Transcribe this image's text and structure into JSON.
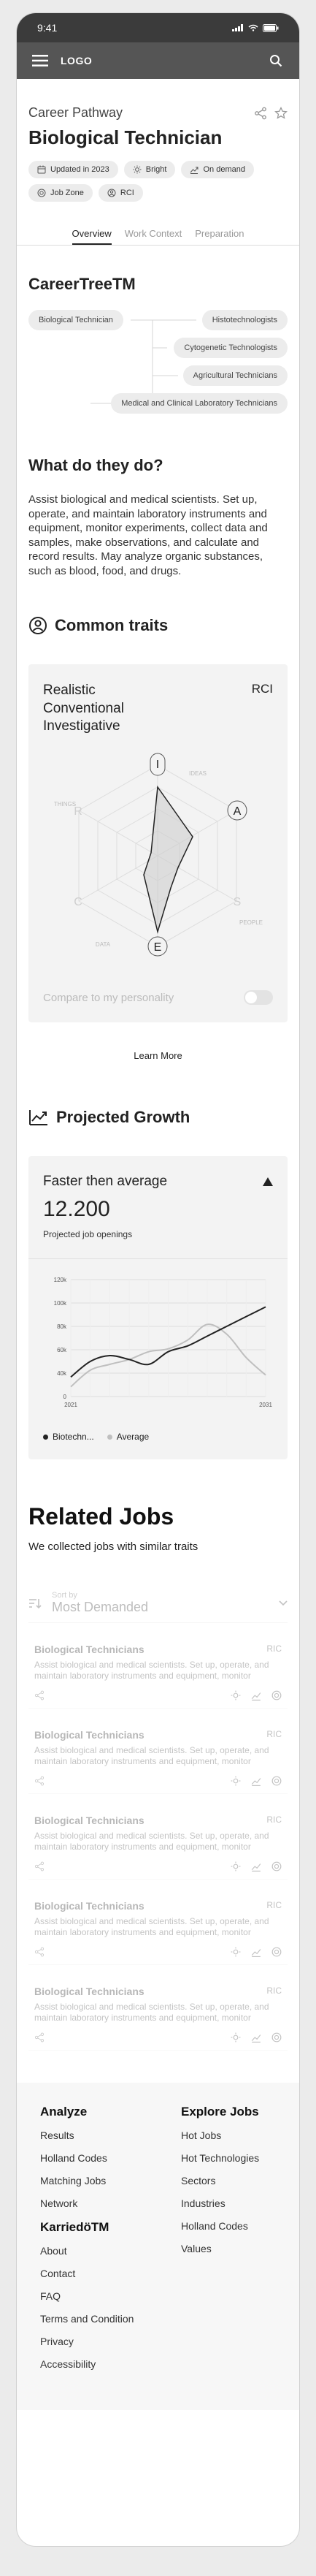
{
  "status_bar": {
    "time": "9:41"
  },
  "app_bar": {
    "logo": "LOGO",
    "menu_icon": "menu-icon",
    "search_icon": "search-icon"
  },
  "header": {
    "subtitle": "Career Pathway",
    "title": "Biological Technician",
    "chips": [
      {
        "label": "Updated in 2023",
        "icon": "calendar-icon"
      },
      {
        "label": "Bright",
        "icon": "sun-icon"
      },
      {
        "label": "On demand",
        "icon": "trend-up-icon"
      },
      {
        "label": "Job Zone",
        "icon": "target-icon"
      },
      {
        "label": "RCI",
        "icon": "user-circle-icon"
      }
    ]
  },
  "tabs": [
    {
      "label": "Overview",
      "active": true
    },
    {
      "label": "Work Context",
      "active": false
    },
    {
      "label": "Preparation",
      "active": false
    }
  ],
  "career_tree": {
    "title": "CareerTreeTM",
    "root": "Biological Technician",
    "children": [
      "Histotechnologists",
      "Cytogenetic Technologists",
      "Agricultural Technicians",
      "Medical and Clinical Laboratory Technicians"
    ]
  },
  "what_they_do": {
    "title": "What do they do?",
    "text": "Assist biological and medical scientists. Set up, operate, and maintain laboratory instruments and equipment, monitor experiments, collect data and samples, make observations, and calculate and record results. May analyze organic substances, such as blood, food, and drugs."
  },
  "traits": {
    "title": "Common traits",
    "names": [
      "Realistic",
      "Conventional",
      "Investigative"
    ],
    "code": "RCI",
    "axis_letters": [
      "I",
      "A",
      "S",
      "E",
      "C",
      "R"
    ],
    "axis_words": [
      "IDEAS",
      "PEOPLE",
      "DATA",
      "THINGS"
    ],
    "compare_label": "Compare to my personality",
    "learn_more": "Learn More"
  },
  "growth": {
    "title": "Projected Growth",
    "label": "Faster then average",
    "value": "12.200",
    "caption": "Projected job openings",
    "legend": [
      "Biotechn...",
      "Average"
    ]
  },
  "chart_data": {
    "type": "line",
    "x": [
      2021,
      2022,
      2023,
      2024,
      2025,
      2026,
      2027,
      2028,
      2029,
      2030,
      2031
    ],
    "series": [
      {
        "name": "Biotechn...",
        "values": [
          20000,
          36000,
          42000,
          38000,
          33000,
          46000,
          52000,
          62000,
          72000,
          82000,
          92000
        ]
      },
      {
        "name": "Average",
        "values": [
          10000,
          27000,
          33000,
          38000,
          46000,
          49000,
          58000,
          74000,
          64000,
          40000,
          22000
        ]
      }
    ],
    "y_ticks": [
      "120k",
      "100k",
      "80k",
      "60k",
      "40k",
      "0"
    ],
    "x_tick_labels": [
      "2021",
      "2031"
    ],
    "ylim": [
      0,
      120000
    ],
    "colors": {
      "Biotechn...": "#222222",
      "Average": "#bfbfbf"
    },
    "grid": true,
    "legend_position": "bottom-left"
  },
  "related": {
    "title": "Related Jobs",
    "subtitle": "We collected jobs with similar traits",
    "sort_label": "Sort by",
    "sort_value": "Most Demanded",
    "jobs": [
      {
        "title": "Biological Technicians",
        "code": "RIC",
        "desc": "Assist biological and medical scientists. Set up, operate, and maintain laboratory instruments and equipment, monitor"
      },
      {
        "title": "Biological Technicians",
        "code": "RIC",
        "desc": "Assist biological and medical scientists. Set up, operate, and maintain laboratory instruments and equipment, monitor"
      },
      {
        "title": "Biological Technicians",
        "code": "RIC",
        "desc": "Assist biological and medical scientists. Set up, operate, and maintain laboratory instruments and equipment, monitor"
      },
      {
        "title": "Biological Technicians",
        "code": "RIC",
        "desc": "Assist biological and medical scientists. Set up, operate, and maintain laboratory instruments and equipment, monitor"
      },
      {
        "title": "Biological Technicians",
        "code": "RIC",
        "desc": "Assist biological and medical scientists. Set up, operate, and maintain laboratory instruments and equipment, monitor"
      }
    ]
  },
  "footer": {
    "analyze": {
      "title": "Analyze",
      "links": [
        "Results",
        "Holland Codes",
        "Matching Jobs",
        "Network"
      ]
    },
    "karriere": {
      "title": "KarriedöTM",
      "links": [
        "About",
        "Contact",
        "FAQ",
        "Terms and Condition",
        "Privacy",
        "Accessibility"
      ]
    },
    "explore": {
      "title": "Explore Jobs",
      "links": [
        "Hot Jobs",
        "Hot Technologies",
        "Sectors",
        "Industries",
        "Holland Codes",
        "Values"
      ]
    }
  }
}
